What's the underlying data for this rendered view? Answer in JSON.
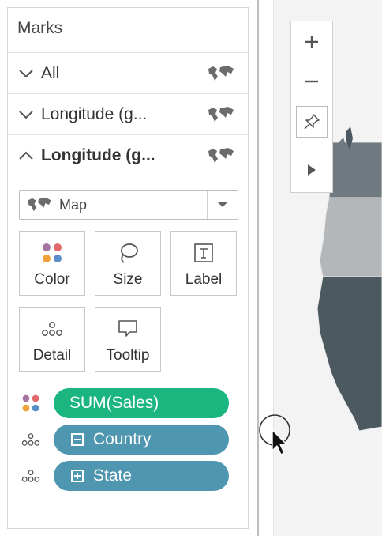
{
  "panel": {
    "title": "Marks",
    "cards": [
      {
        "label": "All",
        "expanded": false,
        "icon": "map-icon"
      },
      {
        "label": "Longitude (g...",
        "expanded": false,
        "icon": "map-icon"
      },
      {
        "label": "Longitude (g...",
        "expanded": true,
        "icon": "map-icon"
      }
    ]
  },
  "mark_type": {
    "selected": "Map",
    "icon": "map-icon",
    "dropdown_icon": "caret-down-icon"
  },
  "buttons": [
    {
      "label": "Color",
      "icon": "color-dots-icon"
    },
    {
      "label": "Size",
      "icon": "size-lasso-icon"
    },
    {
      "label": "Label",
      "icon": "label-t-icon"
    },
    {
      "label": "Detail",
      "icon": "detail-dots-icon"
    },
    {
      "label": "Tooltip",
      "icon": "tooltip-icon"
    }
  ],
  "fields": [
    {
      "label": "SUM(Sales)",
      "role_icon": "color-dots-icon",
      "color": "#1bb580"
    },
    {
      "label": "Country",
      "role_icon": "detail-dots-icon",
      "hierarchy": "collapse",
      "color": "#4f96b0"
    },
    {
      "label": "State",
      "role_icon": "detail-dots-icon",
      "hierarchy": "expand",
      "color": "#4f96b0"
    }
  ],
  "map_controls": {
    "zoom_in": "plus-icon",
    "zoom_out": "minus-icon",
    "pin": "pin-icon",
    "expand": "play-icon"
  },
  "colors": {
    "green_pill": "#1bb580",
    "blue_pill": "#4f96b0",
    "map_dark": "#4d5960",
    "map_mid": "#b3b7b9"
  }
}
